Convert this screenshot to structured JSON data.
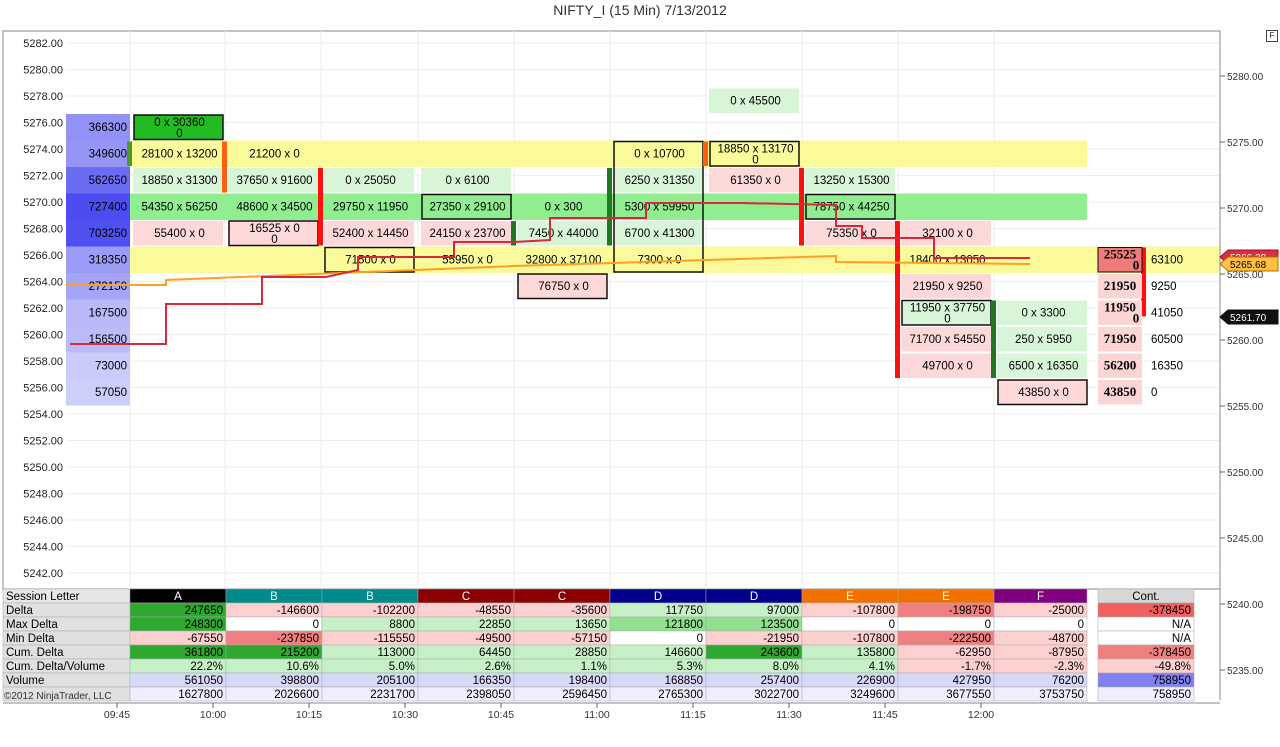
{
  "window": {
    "title": "NIFTY_I (15 Min)  7/13/2012",
    "corner_button": "F"
  },
  "copyright": "©2012 NinjaTrader, LLC",
  "colors": {
    "highlight_band": "#fafa9a",
    "green_band": "#90ee90",
    "orange_line": "#ffa020",
    "red_line": "#d8283c",
    "pos_bar": "#1f7a1f",
    "neg_bar": "#ff1010"
  },
  "axes": {
    "left_prices": [
      "5282.00",
      "5280.00",
      "5278.00",
      "5276.00",
      "5274.00",
      "5272.00",
      "5270.00",
      "5268.00",
      "5266.00",
      "5264.00",
      "5262.00",
      "5260.00",
      "5258.00",
      "5256.00",
      "5254.00",
      "5252.00",
      "5250.00",
      "5248.00",
      "5246.00",
      "5244.00",
      "5242.00"
    ],
    "right_prices": [
      "5280.00",
      "5275.00",
      "5270.00",
      "5265.00",
      "5260.00",
      "5255.00",
      "5250.00",
      "5245.00",
      "5240.00",
      "5235.00"
    ],
    "time_labels": [
      "09:45",
      "10:00",
      "10:15",
      "10:30",
      "10:45",
      "11:00",
      "11:15",
      "11:30",
      "11:45",
      "12:00"
    ],
    "price_tags": [
      "5266.38",
      "5265.68",
      "5261.70"
    ]
  },
  "volume_profile": [
    {
      "price": "5276.00",
      "vol": "366300"
    },
    {
      "price": "5274.00",
      "vol": "349600"
    },
    {
      "price": "5272.00",
      "vol": "562650"
    },
    {
      "price": "5270.00",
      "vol": "727400"
    },
    {
      "price": "5268.00",
      "vol": "703250"
    },
    {
      "price": "5266.00",
      "vol": "318350"
    },
    {
      "price": "5264.00",
      "vol": "272150"
    },
    {
      "price": "5262.00",
      "vol": "167500"
    },
    {
      "price": "5260.00",
      "vol": "156500"
    },
    {
      "price": "5258.00",
      "vol": "73000"
    },
    {
      "price": "5256.00",
      "vol": "57050"
    }
  ],
  "footprint": [
    {
      "row": 0,
      "col": 0,
      "text": "0 x 30360",
      "sub": "0"
    },
    {
      "row": 1,
      "col": 0,
      "text": "28100 x 13200"
    },
    {
      "row": 1,
      "col": 1,
      "text": "21200 x 0"
    },
    {
      "row": 2,
      "col": 0,
      "text": "18850 x 31300"
    },
    {
      "row": 2,
      "col": 1,
      "text": "37650 x 91600"
    },
    {
      "row": 2,
      "col": 2,
      "text": "0 x 25050"
    },
    {
      "row": 2,
      "col": 3,
      "text": "0 x 6100"
    },
    {
      "row": 3,
      "col": 0,
      "text": "54350 x 56250"
    },
    {
      "row": 3,
      "col": 1,
      "text": "48600 x 34500"
    },
    {
      "row": 3,
      "col": 2,
      "text": "29750 x 11950"
    },
    {
      "row": 3,
      "col": 3,
      "text": "27350 x 29100"
    },
    {
      "row": 3,
      "col": 4,
      "text": "0 x 300"
    },
    {
      "row": 4,
      "col": 0,
      "text": "55400 x 0"
    },
    {
      "row": 4,
      "col": 1,
      "text": "16525 x 0",
      "sub": "0"
    },
    {
      "row": 4,
      "col": 2,
      "text": "52400 x 14450"
    },
    {
      "row": 4,
      "col": 3,
      "text": "24150 x 23700"
    },
    {
      "row": 4,
      "col": 4,
      "text": "7450 x 44000"
    },
    {
      "row": 5,
      "col": 2,
      "text": "71500 x 0"
    },
    {
      "row": 5,
      "col": 3,
      "text": "55950 x 0"
    },
    {
      "row": 5,
      "col": 4,
      "text": "32800 x 37100"
    },
    {
      "row": 6,
      "col": 4,
      "text": "76750 x 0"
    },
    {
      "row": -1,
      "col": 6,
      "text": "0 x 45500"
    },
    {
      "row": 1,
      "col": 5,
      "text": "0 x 10700"
    },
    {
      "row": 1,
      "col": 6,
      "text": "18850 x 13170",
      "sub": "0"
    },
    {
      "row": 2,
      "col": 5,
      "text": "6250 x 31350"
    },
    {
      "row": 2,
      "col": 6,
      "text": "61350 x 0"
    },
    {
      "row": 2,
      "col": 7,
      "text": "13250 x 15300"
    },
    {
      "row": 3,
      "col": 5,
      "text": "5300 x 59950"
    },
    {
      "row": 3,
      "col": 7,
      "text": "78750 x 44250"
    },
    {
      "row": 4,
      "col": 5,
      "text": "6700 x 41300"
    },
    {
      "row": 4,
      "col": 7,
      "text": "75350 x 0"
    },
    {
      "row": 4,
      "col": 8,
      "text": "32100 x 0"
    },
    {
      "row": 5,
      "col": 5,
      "text": "7300 x 0"
    },
    {
      "row": 5,
      "col": 8,
      "text": "18400 x 13050"
    },
    {
      "row": 6,
      "col": 8,
      "text": "21950 x 9250"
    },
    {
      "row": 7,
      "col": 8,
      "text": "11950 x 37750",
      "sub": "0"
    },
    {
      "row": 7,
      "col": 9,
      "text": "0 x 3300"
    },
    {
      "row": 8,
      "col": 8,
      "text": "71700 x 54550"
    },
    {
      "row": 8,
      "col": 9,
      "text": "250 x 5950"
    },
    {
      "row": 9,
      "col": 8,
      "text": "49700 x 0"
    },
    {
      "row": 9,
      "col": 9,
      "text": "6500 x 16350"
    },
    {
      "row": 10,
      "col": 9,
      "text": "43850 x 0"
    }
  ],
  "current_bar": [
    {
      "row": 5,
      "bid": "25525",
      "sub": "0",
      "ask": "63100"
    },
    {
      "row": 6,
      "bid": "21950",
      "ask": "9250"
    },
    {
      "row": 7,
      "bid": "11950",
      "sub": "0",
      "ask": "41050"
    },
    {
      "row": 8,
      "bid": "71950",
      "ask": "60500"
    },
    {
      "row": 9,
      "bid": "56200",
      "ask": "16350"
    },
    {
      "row": 10,
      "bid": "43850",
      "ask": "0"
    }
  ],
  "stats_table": {
    "headers": [
      "Session Letter",
      "A",
      "B",
      "B",
      "C",
      "C",
      "D",
      "D",
      "E",
      "E",
      "F",
      "Cont."
    ],
    "rows": [
      {
        "label": "Delta",
        "cells": [
          "247650",
          "-146600",
          "-102200",
          "-48550",
          "-35600",
          "117750",
          "97000",
          "-107800",
          "-198750",
          "-25000",
          "-378450"
        ]
      },
      {
        "label": "Max Delta",
        "cells": [
          "248300",
          "0",
          "8800",
          "22850",
          "13650",
          "121800",
          "123500",
          "0",
          "0",
          "0",
          "N/A"
        ]
      },
      {
        "label": "Min Delta",
        "cells": [
          "-67550",
          "-237850",
          "-115550",
          "-49500",
          "-57150",
          "0",
          "-21950",
          "-107800",
          "-222500",
          "-48700",
          "N/A"
        ]
      },
      {
        "label": "Cum. Delta",
        "cells": [
          "361800",
          "215200",
          "113000",
          "64450",
          "28850",
          "146600",
          "243600",
          "135800",
          "-62950",
          "-87950",
          "-378450"
        ]
      },
      {
        "label": "Cum. Delta/Volume",
        "cells": [
          "22.2%",
          "10.6%",
          "5.0%",
          "2.6%",
          "1.1%",
          "5.3%",
          "8.0%",
          "4.1%",
          "-1.7%",
          "-2.3%",
          "-49.8%"
        ]
      },
      {
        "label": "Volume",
        "cells": [
          "561050",
          "398800",
          "205100",
          "166350",
          "198400",
          "168850",
          "257400",
          "226900",
          "427950",
          "76200",
          "758950"
        ]
      },
      {
        "label": "",
        "cells": [
          "1627800",
          "2026600",
          "2231700",
          "2398050",
          "2596450",
          "2765300",
          "3022700",
          "3249600",
          "3677550",
          "3753750",
          "758950"
        ]
      }
    ]
  }
}
